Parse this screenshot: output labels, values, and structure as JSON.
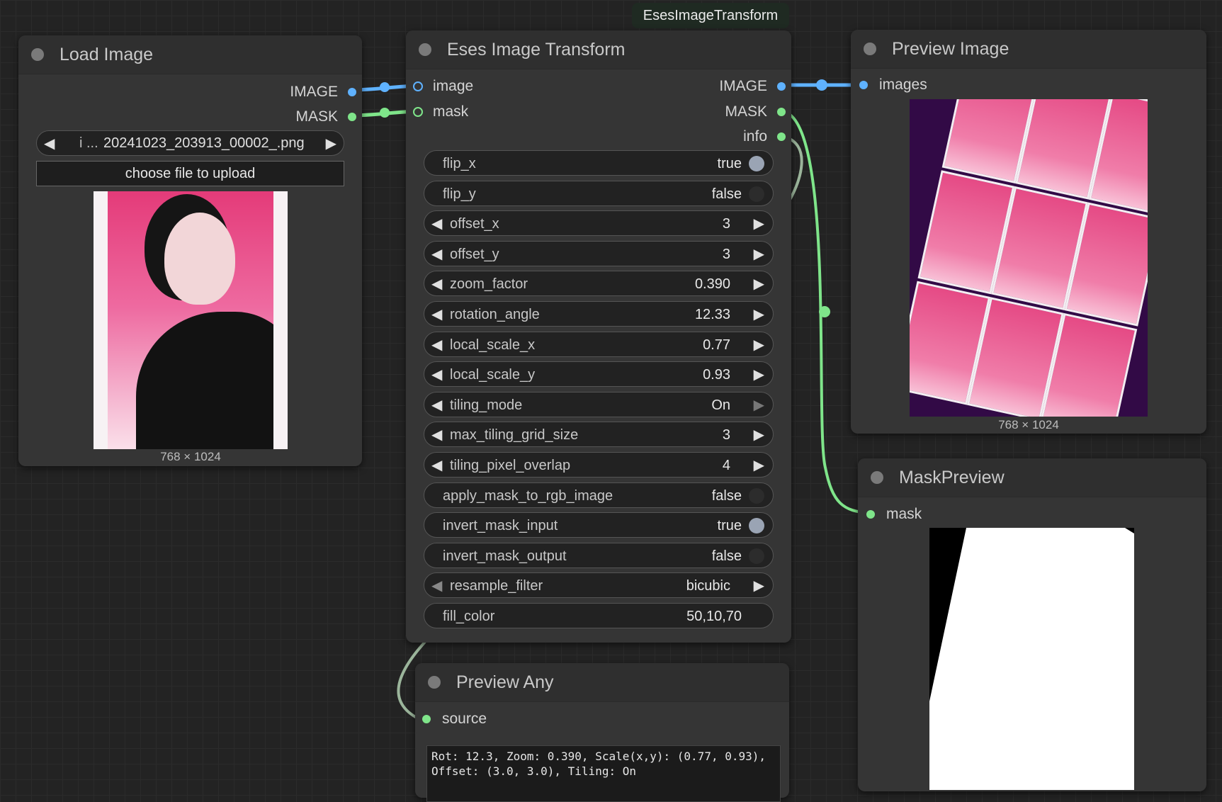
{
  "group_label": "EsesImageTransform",
  "load_image": {
    "title": "Load Image",
    "outputs": [
      "IMAGE",
      "MASK"
    ],
    "file_prefix": "i ...",
    "file_name": "20241023_203913_00002_.png",
    "upload_label": "choose file to upload",
    "size_caption": "768 × 1024"
  },
  "transform": {
    "title": "Eses Image Transform",
    "inputs": [
      "image",
      "mask"
    ],
    "outputs": [
      "IMAGE",
      "MASK",
      "info"
    ],
    "widgets": [
      {
        "label": "flip_x",
        "value": "true",
        "kind": "toggle",
        "on": true
      },
      {
        "label": "flip_y",
        "value": "false",
        "kind": "toggle",
        "on": false
      },
      {
        "label": "offset_x",
        "value": "3",
        "kind": "number"
      },
      {
        "label": "offset_y",
        "value": "3",
        "kind": "number"
      },
      {
        "label": "zoom_factor",
        "value": "0.390",
        "kind": "number"
      },
      {
        "label": "rotation_angle",
        "value": "12.33",
        "kind": "number"
      },
      {
        "label": "local_scale_x",
        "value": "0.77",
        "kind": "number"
      },
      {
        "label": "local_scale_y",
        "value": "0.93",
        "kind": "number"
      },
      {
        "label": "tiling_mode",
        "value": "On",
        "kind": "combo-last"
      },
      {
        "label": "max_tiling_grid_size",
        "value": "3",
        "kind": "number"
      },
      {
        "label": "tiling_pixel_overlap",
        "value": "4",
        "kind": "number"
      },
      {
        "label": "apply_mask_to_rgb_image",
        "value": "false",
        "kind": "toggle",
        "on": false
      },
      {
        "label": "invert_mask_input",
        "value": "true",
        "kind": "toggle",
        "on": true
      },
      {
        "label": "invert_mask_output",
        "value": "false",
        "kind": "toggle",
        "on": false
      },
      {
        "label": "resample_filter",
        "value": "bicubic",
        "kind": "combo-first"
      },
      {
        "label": "fill_color",
        "value": "50,10,70",
        "kind": "text"
      }
    ]
  },
  "preview_image": {
    "title": "Preview Image",
    "input": "images",
    "size_caption": "768 × 1024"
  },
  "mask_preview": {
    "title": "MaskPreview",
    "input": "mask"
  },
  "preview_any": {
    "title": "Preview Any",
    "input": "source",
    "output_line1": "Rot: 12.3, Zoom: 0.390, Scale(x,y): (0.77, 0.93),",
    "output_line2": "Offset: (3.0, 3.0), Tiling: On"
  },
  "colors": {
    "image_link": "#5fb2ff",
    "mask_link": "#7fe58a",
    "fill_color_preview": "#320a46",
    "canvas": "#232323",
    "node": "#353535"
  }
}
